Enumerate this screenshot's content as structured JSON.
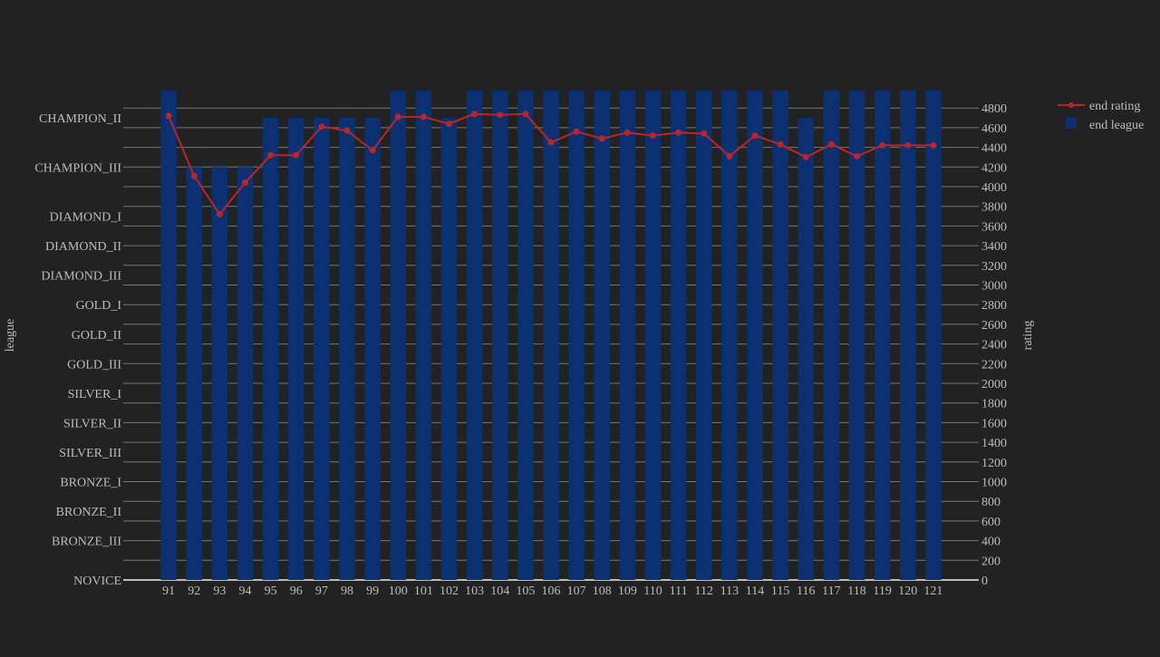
{
  "chart_data": {
    "type": "bar+line",
    "x": [
      91,
      92,
      93,
      94,
      95,
      96,
      97,
      98,
      99,
      100,
      101,
      102,
      103,
      104,
      105,
      106,
      107,
      108,
      109,
      110,
      111,
      112,
      113,
      114,
      115,
      116,
      117,
      118,
      119,
      120,
      121
    ],
    "series": [
      {
        "name": "end league",
        "type": "bar",
        "axis": "left",
        "color": "#0b3172",
        "values": [
          "CHAMPION_I",
          "CHAMPION_III",
          "CHAMPION_III",
          "CHAMPION_III",
          "CHAMPION_II",
          "CHAMPION_II",
          "CHAMPION_II",
          "CHAMPION_II",
          "CHAMPION_II",
          "CHAMPION_I",
          "CHAMPION_I",
          "CHAMPION_II",
          "CHAMPION_I",
          "CHAMPION_I",
          "CHAMPION_I",
          "CHAMPION_I",
          "CHAMPION_I",
          "CHAMPION_I",
          "CHAMPION_I",
          "CHAMPION_I",
          "CHAMPION_I",
          "CHAMPION_I",
          "CHAMPION_I",
          "CHAMPION_I",
          "CHAMPION_I",
          "CHAMPION_II",
          "CHAMPION_I",
          "CHAMPION_I",
          "CHAMPION_I",
          "CHAMPION_I",
          "CHAMPION_I"
        ]
      },
      {
        "name": "end rating",
        "type": "line",
        "axis": "right",
        "color": "#b8262b",
        "values": [
          4720,
          4110,
          3720,
          4040,
          4320,
          4320,
          4610,
          4570,
          4370,
          4710,
          4710,
          4640,
          4740,
          4730,
          4740,
          4450,
          4560,
          4490,
          4550,
          4520,
          4550,
          4540,
          4310,
          4520,
          4430,
          4300,
          4430,
          4310,
          4420,
          4420,
          4420
        ]
      }
    ],
    "left_axis": {
      "label": "league",
      "ticks": [
        "NOVICE",
        "BRONZE_III",
        "BRONZE_II",
        "BRONZE_I",
        "SILVER_III",
        "SILVER_II",
        "SILVER_I",
        "GOLD_III",
        "GOLD_II",
        "GOLD_I",
        "DIAMOND_III",
        "DIAMOND_II",
        "DIAMOND_I",
        "CHAMPION_III",
        "CHAMPION_II"
      ]
    },
    "right_axis": {
      "label": "rating",
      "range": [
        0,
        4977
      ],
      "ticks": [
        0,
        200,
        400,
        600,
        800,
        1000,
        1200,
        1400,
        1600,
        1800,
        2000,
        2200,
        2400,
        2600,
        2800,
        3000,
        3200,
        3400,
        3600,
        3800,
        4000,
        4200,
        4400,
        4600,
        4800
      ]
    },
    "grid": true,
    "legend": {
      "placement": "top-right",
      "entries": [
        "end rating",
        "end league"
      ]
    }
  }
}
